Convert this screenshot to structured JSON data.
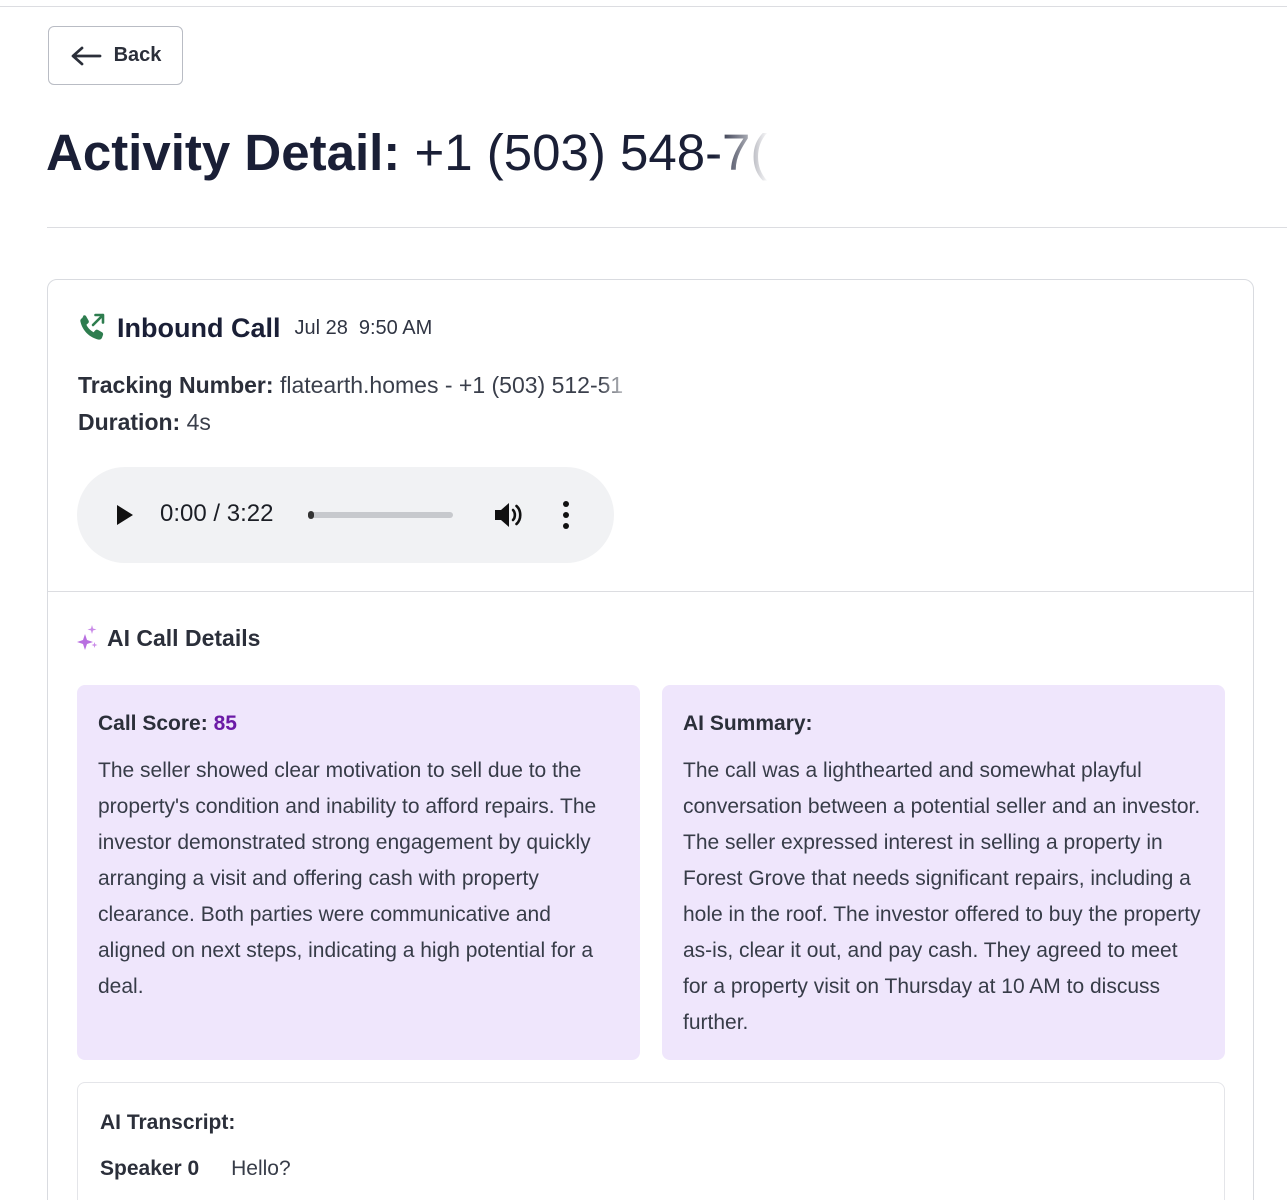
{
  "header": {
    "back_label": "Back",
    "title_label": "Activity Detail:",
    "title_value": "+1 (503) 548-7("
  },
  "call": {
    "type": "Inbound Call",
    "date": "Jul 28",
    "time": "9:50 AM",
    "tracking_label": "Tracking Number:",
    "tracking_value": "flatearth.homes - +1 (503) 512-51",
    "duration_label": "Duration:",
    "duration_value": "4s",
    "icon": "phone-inbound-icon",
    "icon_color": "#2e7d4f"
  },
  "player": {
    "time": "0:00 / 3:22",
    "progress": 0
  },
  "ai": {
    "heading": "AI Call Details",
    "accent": "#6b1aa6",
    "panel_bg": "#efe6fc",
    "score_label": "Call Score:",
    "score_value": "85",
    "score_text": "The seller showed clear motivation to sell due to the property's condition and inability to afford repairs. The investor demonstrated strong engagement by quickly arranging a visit and offering cash with property clearance. Both parties were communicative and aligned on next steps, indicating a high potential for a deal.",
    "summary_label": "AI Summary:",
    "summary_text": "The call was a lighthearted and somewhat playful conversation between a potential seller and an investor. The seller expressed interest in selling a property in Forest Grove that needs significant repairs, including a hole in the roof. The investor offered to buy the property as-is, clear it out, and pay cash. They agreed to meet for a property visit on Thursday at 10 AM to discuss further."
  },
  "transcript": {
    "title": "AI Transcript:",
    "lines": [
      {
        "speaker": "Speaker 0",
        "text": "Hello?"
      }
    ]
  }
}
